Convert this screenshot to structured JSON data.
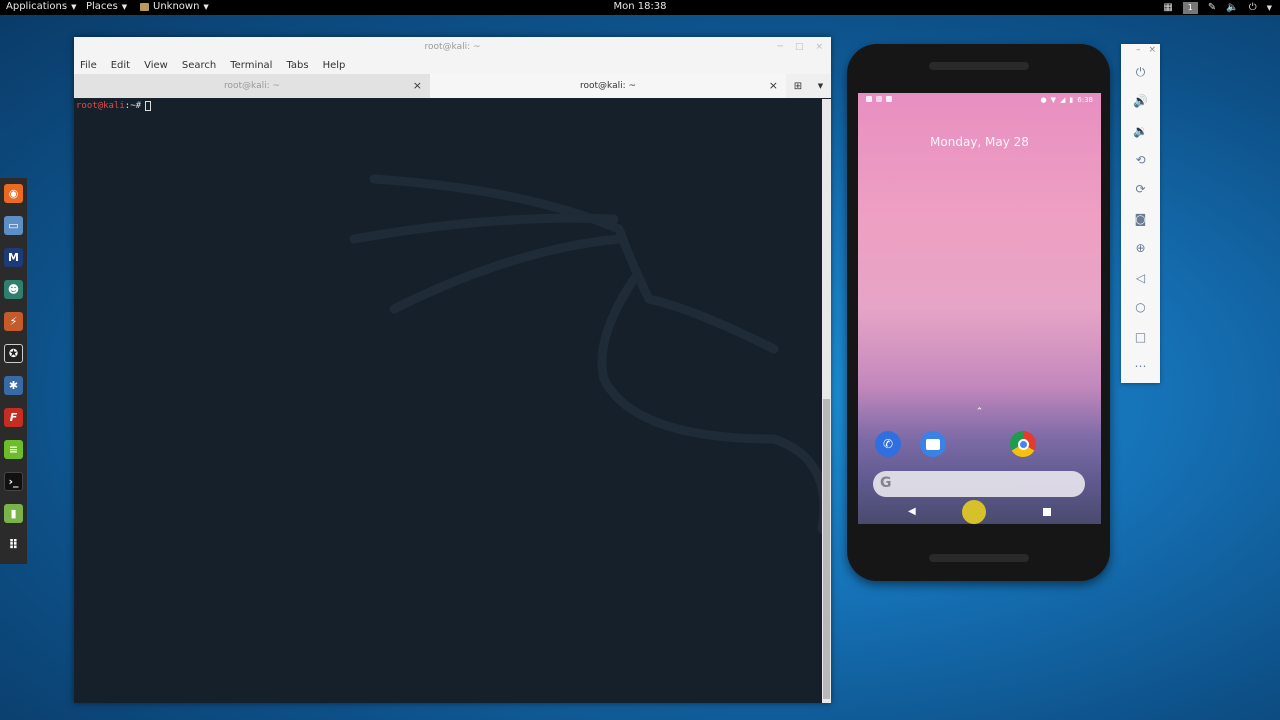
{
  "topbar": {
    "applications": "Applications",
    "places": "Places",
    "unknown": "Unknown",
    "clock": "Mon 18:38",
    "workspace": "1"
  },
  "dock": {
    "items": [
      "firefox",
      "files",
      "metasploit",
      "armitage",
      "burpsuite",
      "faraday",
      "beef",
      "ettercap",
      "leafpad",
      "terminal",
      "editor",
      "show-apps"
    ]
  },
  "terminal": {
    "window_title": "root@kali: ~",
    "menu": [
      "File",
      "Edit",
      "View",
      "Search",
      "Terminal",
      "Tabs",
      "Help"
    ],
    "tabs": [
      {
        "label": "root@kali: ~"
      },
      {
        "label": "root@kali: ~"
      }
    ],
    "prompt_user": "root@kali",
    "prompt_rest": ":~#",
    "tab_close": "×",
    "win_min": "─",
    "win_max": "□",
    "win_close": "×"
  },
  "phone": {
    "date": "Monday, May 28",
    "time": "6:38",
    "search_logo": "G",
    "apps": [
      "phone",
      "messages",
      "chrome"
    ]
  },
  "emulator_panel": {
    "buttons": [
      "power",
      "volume-up",
      "volume-down",
      "rotate-left",
      "rotate-right",
      "screenshot",
      "zoom",
      "back",
      "home",
      "overview",
      "more"
    ]
  },
  "colors": {
    "terminal_bg": "#16202b",
    "prompt_user": "#e04b4b",
    "desktop_accent": "#1673b8"
  }
}
